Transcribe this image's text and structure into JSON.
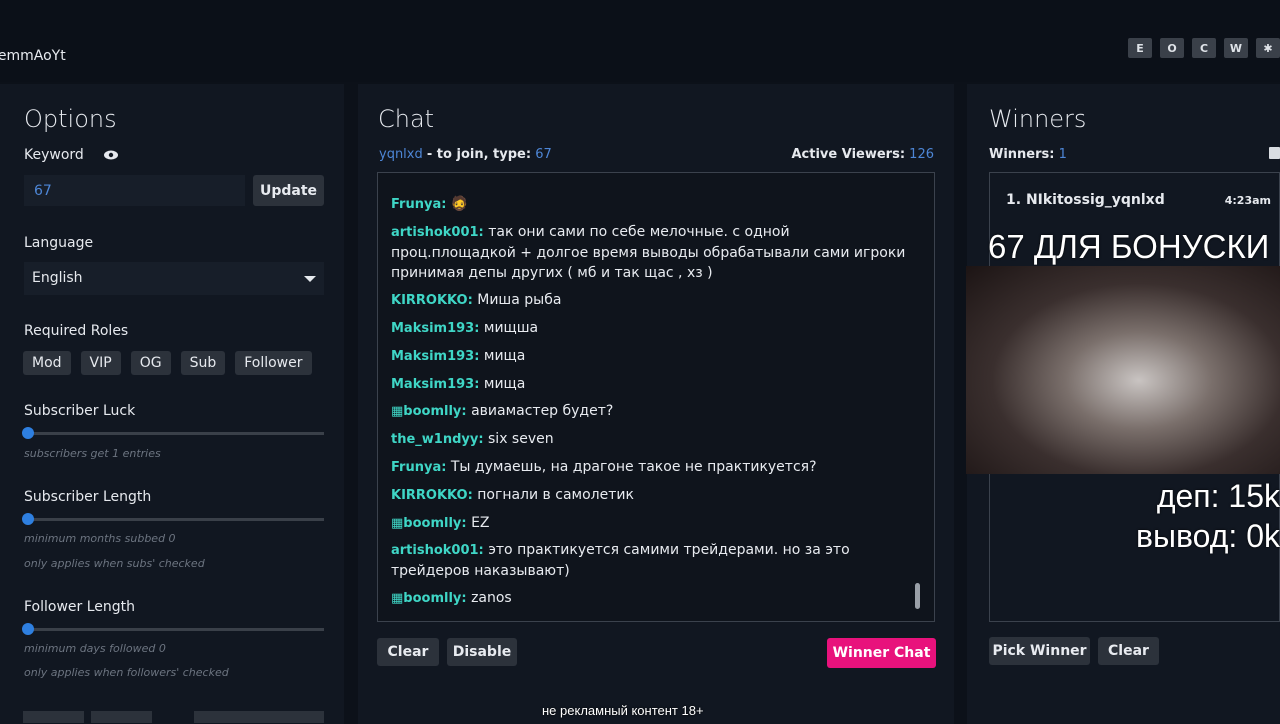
{
  "header": {
    "username": "iemmAoYt",
    "buttons": [
      "E",
      "O",
      "C",
      "W",
      "✱"
    ]
  },
  "options": {
    "title": "Options",
    "keyword_label": "Keyword",
    "keyword_value": "67",
    "update_button": "Update",
    "language_label": "Language",
    "language_value": "English",
    "roles_label": "Required Roles",
    "roles": [
      "Mod",
      "VIP",
      "OG",
      "Sub",
      "Follower"
    ],
    "sub_luck_label": "Subscriber Luck",
    "sub_luck_note": "subscribers get 1 entries",
    "sub_length_label": "Subscriber Length",
    "sub_length_note1": "minimum months subbed 0",
    "sub_length_note2": "only applies when subs' checked",
    "follower_length_label": "Follower Length",
    "follower_length_note1": "minimum days followed 0",
    "follower_length_note2": "only applies when followers' checked"
  },
  "chat": {
    "title": "Chat",
    "join_user": "yqnlxd",
    "join_text": "- to join, type:",
    "join_keyword": "67",
    "active_label": "Active Viewers:",
    "active_count": "126",
    "messages": [
      {
        "name": "Frunya:",
        "text": "🧔"
      },
      {
        "name": "artishok001:",
        "text": "так они сами по себе мелочные. с одной проц.площадкой + долгое время выводы обрабатывали сами игроки принимая депы других ( мб и так щас , хз )"
      },
      {
        "name": "KIRROKKO:",
        "text": "Миша рыба"
      },
      {
        "name": "Maksim193:",
        "text": "мищша"
      },
      {
        "name": "Maksim193:",
        "text": "мища"
      },
      {
        "name": "Maksim193:",
        "text": "мища"
      },
      {
        "name": "boomlly:",
        "text": "авиамастер будет?"
      },
      {
        "name": "the_w1ndyy:",
        "text": "six seven"
      },
      {
        "name": "Frunya:",
        "text": "Ты думаешь, на драгоне такое не практикуется?"
      },
      {
        "name": "KIRROKKO:",
        "text": "погнали в самолетик"
      },
      {
        "name": "boomlly:",
        "text": "EZ"
      },
      {
        "name": "artishok001:",
        "text": "это практикуется самими трейдерами. но за это трейдеров наказывают)"
      },
      {
        "name": "boomlly:",
        "text": "zanos"
      }
    ],
    "clear_button": "Clear",
    "disable_button": "Disable",
    "winner_chat_button": "Winner Chat"
  },
  "winners": {
    "title": "Winners",
    "count_label": "Winners:",
    "count": "1",
    "list": [
      {
        "rank": "1.",
        "name": "NIkitossig_yqnlxd",
        "time": "4:23am"
      }
    ],
    "pick_button": "Pick Winner",
    "clear_button": "Clear"
  },
  "stream_overlay": {
    "bonus_text": "67 ДЛЯ БОНУСКИ",
    "dep_text": "деп: 15k",
    "withdraw_text": "вывод: 0k",
    "caption": "не рекламный контент 18+"
  }
}
